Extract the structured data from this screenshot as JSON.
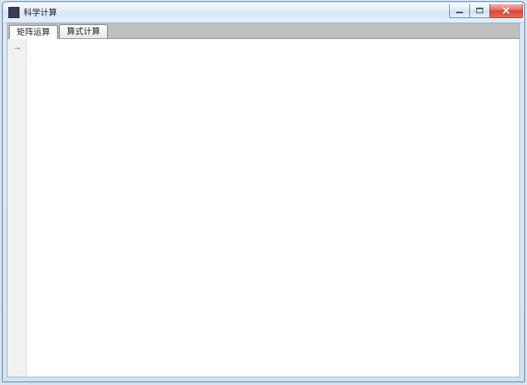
{
  "window": {
    "title": "科学计算"
  },
  "tabs": [
    {
      "label": "矩阵运算",
      "active": true
    },
    {
      "label": "算式计算",
      "active": false
    }
  ],
  "prompt_glyph": "→"
}
